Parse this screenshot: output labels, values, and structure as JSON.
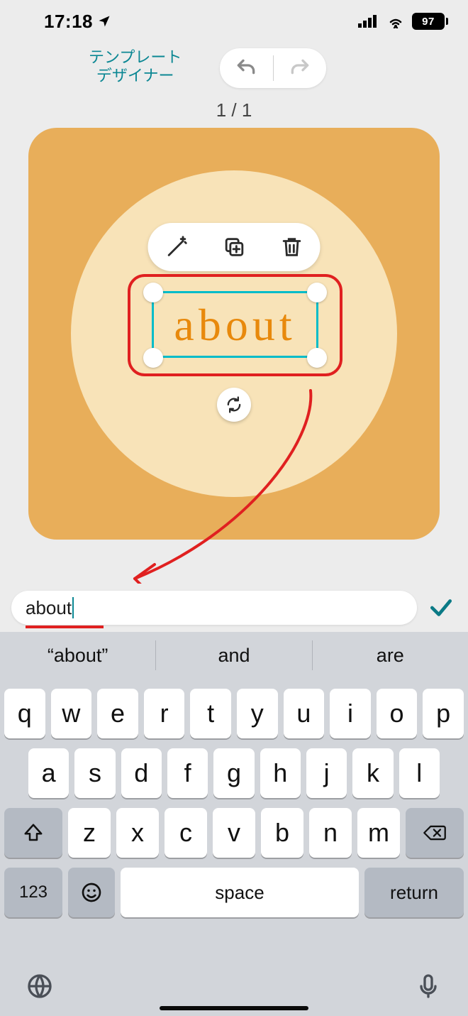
{
  "status": {
    "time": "17:18",
    "battery": "97"
  },
  "header": {
    "app_name_line1": "テンプレート",
    "app_name_line2": "デザイナー"
  },
  "pager": {
    "label": "1 / 1"
  },
  "canvas": {
    "text_value": "about"
  },
  "input": {
    "value": "about"
  },
  "keyboard": {
    "suggestions": [
      "“about”",
      "and",
      "are"
    ],
    "row1": [
      "q",
      "w",
      "e",
      "r",
      "t",
      "y",
      "u",
      "i",
      "o",
      "p"
    ],
    "row2": [
      "a",
      "s",
      "d",
      "f",
      "g",
      "h",
      "j",
      "k",
      "l"
    ],
    "row3": [
      "z",
      "x",
      "c",
      "v",
      "b",
      "n",
      "m"
    ],
    "numkey": "123",
    "space": "space",
    "return": "return"
  }
}
